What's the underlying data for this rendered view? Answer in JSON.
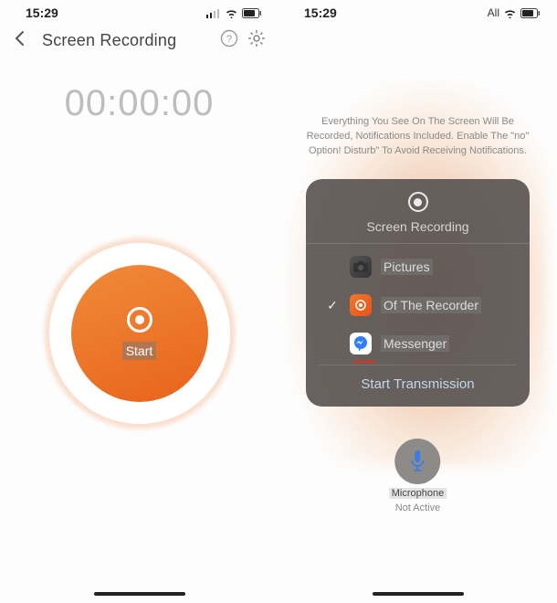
{
  "left": {
    "status": {
      "time": "15:29"
    },
    "nav": {
      "title": "Screen Recording"
    },
    "timer": "00:00:00",
    "start_label": "Start"
  },
  "right": {
    "status": {
      "time": "15:29",
      "network": "All"
    },
    "instruction": "Everything You See On The Screen Will Be Recorded, Notifications Included. Enable The \"no\" Option! Disturb\" To Avoid Receiving Notifications.",
    "panel": {
      "title": "Screen Recording",
      "items": [
        {
          "label": "Pictures",
          "icon": "photos",
          "selected": false
        },
        {
          "label": "Of The Recorder",
          "icon": "recorder",
          "selected": true
        },
        {
          "label": "Messenger",
          "icon": "messenger",
          "selected": false
        }
      ],
      "action": "Start Transmission"
    },
    "mic": {
      "label": "Microphone",
      "status": "Not Active"
    }
  }
}
